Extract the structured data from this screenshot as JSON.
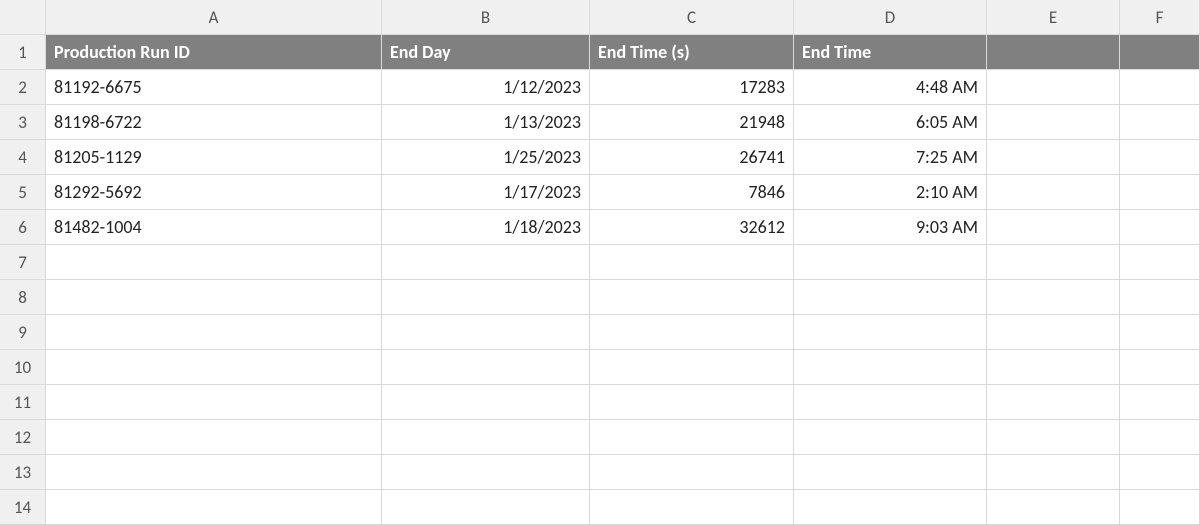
{
  "columns": [
    "A",
    "B",
    "C",
    "D",
    "E",
    "F"
  ],
  "rowNumbers": [
    "1",
    "2",
    "3",
    "4",
    "5",
    "6",
    "7",
    "8",
    "9",
    "10",
    "11",
    "12",
    "13",
    "14"
  ],
  "headers": {
    "A": "Production Run ID",
    "B": "End Day",
    "C": "End Time (s)",
    "D": "End Time",
    "E": "",
    "F": ""
  },
  "rows": [
    {
      "A": "81192-6675",
      "B": "1/12/2023",
      "C": "17283",
      "D": "4:48 AM"
    },
    {
      "A": "81198-6722",
      "B": "1/13/2023",
      "C": "21948",
      "D": "6:05 AM"
    },
    {
      "A": "81205-1129",
      "B": "1/25/2023",
      "C": "26741",
      "D": "7:25 AM"
    },
    {
      "A": "81292-5692",
      "B": "1/17/2023",
      "C": "7846",
      "D": "2:10 AM"
    },
    {
      "A": "81482-1004",
      "B": "1/18/2023",
      "C": "32612",
      "D": "9:03 AM"
    }
  ]
}
